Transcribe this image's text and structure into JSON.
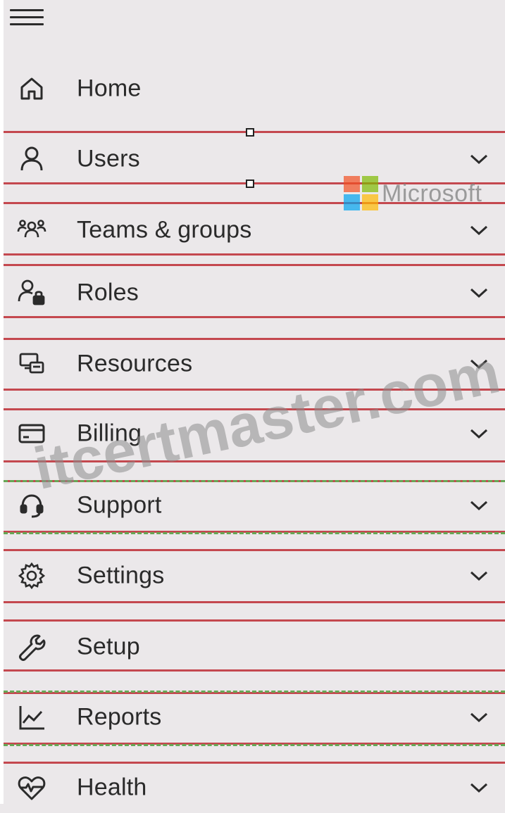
{
  "nav": {
    "items": [
      {
        "label": "Home",
        "icon": "home-icon",
        "expandable": false
      },
      {
        "label": "Users",
        "icon": "user-icon",
        "expandable": true
      },
      {
        "label": "Teams & groups",
        "icon": "teams-groups-icon",
        "expandable": true
      },
      {
        "label": "Roles",
        "icon": "roles-icon",
        "expandable": true
      },
      {
        "label": "Resources",
        "icon": "resources-icon",
        "expandable": true
      },
      {
        "label": "Billing",
        "icon": "billing-card-icon",
        "expandable": true
      },
      {
        "label": "Support",
        "icon": "support-headset-icon",
        "expandable": true
      },
      {
        "label": "Settings",
        "icon": "gear-icon",
        "expandable": true
      },
      {
        "label": "Setup",
        "icon": "wrench-icon",
        "expandable": false
      },
      {
        "label": "Reports",
        "icon": "line-chart-icon",
        "expandable": true
      },
      {
        "label": "Health",
        "icon": "heart-pulse-icon",
        "expandable": true
      }
    ]
  },
  "overlay": {
    "logo_text": "Microsoft",
    "watermark_text": "itcertmaster.com"
  },
  "colors": {
    "background": "#ebe8ea",
    "text": "#2a2a2a",
    "highlight_line": "#c4484f",
    "dashed_line": "#66a755"
  }
}
